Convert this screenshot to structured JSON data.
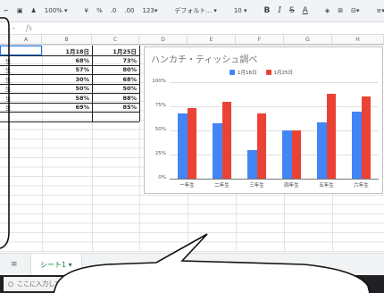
{
  "toolbar": {
    "zoom": "100%",
    "currency": "¥",
    "percent": "%",
    "dec_decrease": ".0",
    "dec_increase": ".00",
    "format_more": "123",
    "font": "デフォルト...",
    "font_size": "10",
    "bold": "B",
    "italic": "I",
    "strike": "S",
    "text_color": "A"
  },
  "formula": {
    "fx": "fx",
    "ref": "-"
  },
  "columns": [
    "A",
    "B",
    "C",
    "D",
    "E",
    "F",
    "G",
    "H"
  ],
  "table": {
    "headers": [
      "1月18日",
      "1月25日"
    ],
    "col_a": [
      "生",
      "生",
      "生",
      "生",
      "生",
      "生"
    ],
    "col_b": [
      "68%",
      "57%",
      "30%",
      "50%",
      "58%",
      "69%"
    ],
    "col_c": [
      "73%",
      "80%",
      "68%",
      "50%",
      "88%",
      "85%"
    ]
  },
  "chart_data": {
    "type": "bar",
    "title": "ハンカチ・ティッシュ調べ",
    "categories": [
      "一年生",
      "二年生",
      "三年生",
      "四年生",
      "五年生",
      "六年生"
    ],
    "series": [
      {
        "name": "1月18日",
        "values": [
          68,
          57,
          30,
          50,
          58,
          69
        ],
        "color": "#4285f4"
      },
      {
        "name": "1月25日",
        "values": [
          73,
          80,
          68,
          50,
          88,
          85
        ],
        "color": "#ea4335"
      }
    ],
    "yticks": [
      "100%",
      "75%",
      "50%",
      "25%",
      "0%"
    ],
    "ylim": [
      0,
      100
    ],
    "legend": "top"
  },
  "sheet": {
    "menu_icon": "≡",
    "tab_label": "シート1 ▾"
  },
  "taskbar": {
    "search_placeholder": "ここに入力して検索"
  }
}
